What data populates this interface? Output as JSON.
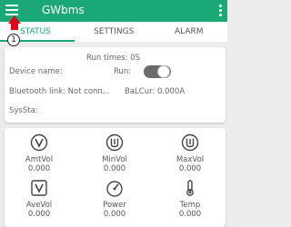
{
  "app": {
    "title": "GWbms",
    "menu_icon": "hamburger-menu-icon",
    "overflow_icon": "overflow-menu-icon",
    "accent": "#1aa876"
  },
  "tabs": [
    {
      "label": "STATUS",
      "active": true
    },
    {
      "label": "SETTINGS",
      "active": false
    },
    {
      "label": "ALARM",
      "active": false
    }
  ],
  "annotation": {
    "number": "1",
    "color": "#e0001a"
  },
  "info": {
    "run_times": "Run times:  0S",
    "device_name_label": "Device name:",
    "run_label": "Run:",
    "run_toggle_on": false,
    "bluetooth_link": "Bluetooth link:  Not conn...",
    "bal_cur": "BaLCur:  0.000A",
    "sys_sta": "SysSta:"
  },
  "metrics": [
    {
      "label": "AmtVol",
      "value": "0.000",
      "icon": "voltage-gauge-icon"
    },
    {
      "label": "MinVol",
      "value": "0.000",
      "icon": "min-voltage-icon"
    },
    {
      "label": "MaxVol",
      "value": "0.000",
      "icon": "max-voltage-icon"
    },
    {
      "label": "AveVol",
      "value": "0.000",
      "icon": "average-voltage-icon"
    },
    {
      "label": "Power",
      "value": "0.000",
      "icon": "speedometer-icon"
    },
    {
      "label": "Temp",
      "value": "0.000",
      "icon": "thermometer-icon"
    }
  ]
}
